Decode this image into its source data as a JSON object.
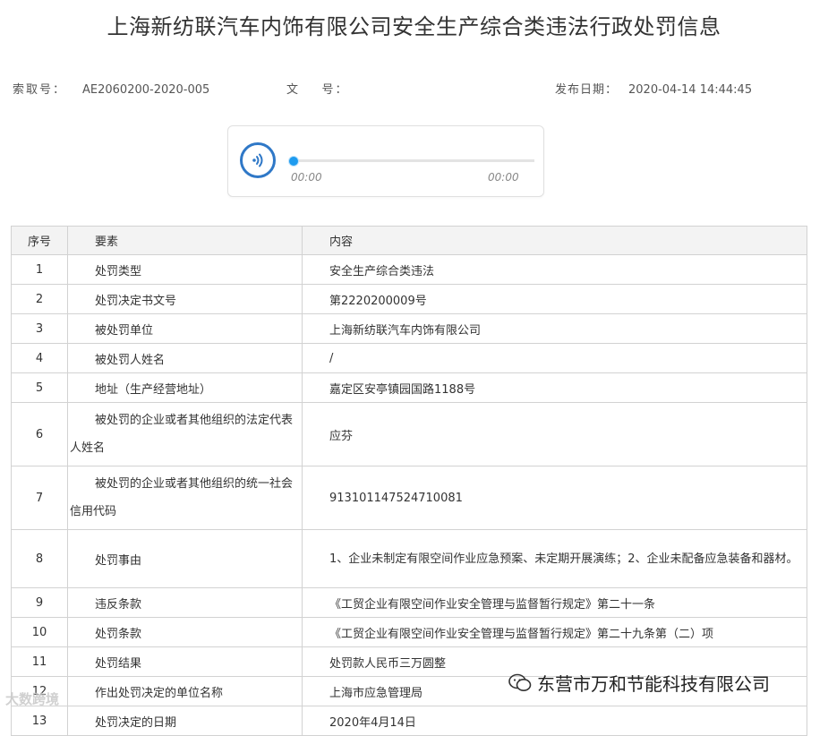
{
  "title": "上海新纺联汽车内饰有限公司安全生产综合类违法行政处罚信息",
  "meta": {
    "index_label": "索取号：",
    "index_value": "AE2060200-2020-005",
    "doc_label": "文    号：",
    "doc_value": "",
    "date_label": "发布日期：",
    "date_value": "2020-04-14 14:44:45"
  },
  "player": {
    "current_time": "00:00",
    "total_time": "00:00",
    "progress": 0
  },
  "table": {
    "headers": [
      "序号",
      "要素",
      "内容"
    ],
    "rows": [
      {
        "no": "1",
        "item": "处罚类型",
        "content": "安全生产综合类违法"
      },
      {
        "no": "2",
        "item": "处罚决定书文号",
        "content": "第2220200009号"
      },
      {
        "no": "3",
        "item": "被处罚单位",
        "content": "上海新纺联汽车内饰有限公司"
      },
      {
        "no": "4",
        "item": "被处罚人姓名",
        "content": "/"
      },
      {
        "no": "5",
        "item": "地址（生产经营地址）",
        "content": "嘉定区安亭镇园国路1188号"
      },
      {
        "no": "6",
        "item": "被处罚的企业或者其他组织的法定代表人姓名",
        "content": "应芬"
      },
      {
        "no": "7",
        "item": "被处罚的企业或者其他组织的统一社会信用代码",
        "content": "913101147524710081"
      },
      {
        "no": "8",
        "item": "处罚事由",
        "content": "1、企业未制定有限空间作业应急预案、未定期开展演练；2、企业未配备应急装备和器材。"
      },
      {
        "no": "9",
        "item": "违反条款",
        "content": "《工贸企业有限空间作业安全管理与监督暂行规定》第二十一条"
      },
      {
        "no": "10",
        "item": "处罚条款",
        "content": "《工贸企业有限空间作业安全管理与监督暂行规定》第二十九条第（二）项"
      },
      {
        "no": "11",
        "item": "处罚结果",
        "content": "处罚款人民币三万圆整"
      },
      {
        "no": "12",
        "item": "作出处罚决定的单位名称",
        "content": "上海市应急管理局"
      },
      {
        "no": "13",
        "item": "处罚决定的日期",
        "content": "2020年4月14日"
      }
    ]
  },
  "watermarks": {
    "left": "大数跨境",
    "right": "东营市万和节能科技有限公司"
  }
}
